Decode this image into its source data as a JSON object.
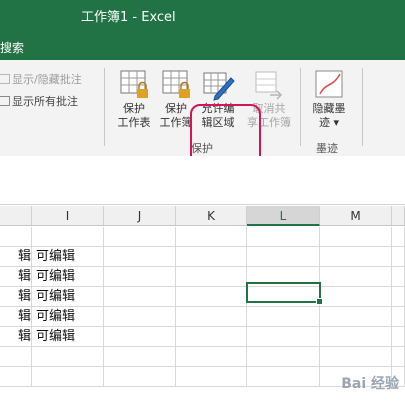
{
  "window": {
    "title": "工作簿1  -  Excel"
  },
  "tabbar": {
    "search": "搜索"
  },
  "ribbon": {
    "comment_cmds": [
      {
        "label": "显示/隐藏批注",
        "enabled": false
      },
      {
        "label": "显示所有批注",
        "enabled": true
      }
    ],
    "protect_buttons": [
      {
        "line1": "保护",
        "line2": "工作表",
        "enabled": true
      },
      {
        "line1": "保护",
        "line2": "工作簿",
        "enabled": true
      },
      {
        "line1": "允许编",
        "line2": "辑区域",
        "enabled": true
      },
      {
        "line1": "取消共",
        "line2": "享工作簿",
        "enabled": false
      }
    ],
    "protect_group": "保护",
    "ink_button": {
      "line1": "隐藏墨",
      "line2": "迹 ▾"
    },
    "ink_group": "墨迹"
  },
  "grid": {
    "columns": [
      "",
      "I",
      "J",
      "K",
      "L",
      "M"
    ],
    "selected_column": "L",
    "rows": [
      [
        "",
        ""
      ],
      [
        "辑",
        "可编辑"
      ],
      [
        "辑",
        "可编辑"
      ],
      [
        "辑",
        "可编辑"
      ],
      [
        "辑",
        "可编辑"
      ],
      [
        "辑",
        "可编辑"
      ],
      [
        "",
        ""
      ],
      [
        "",
        ""
      ]
    ]
  },
  "watermark": "Bai 经验",
  "colors": {
    "excel_green": "#217346",
    "highlight": "#d4145a"
  }
}
